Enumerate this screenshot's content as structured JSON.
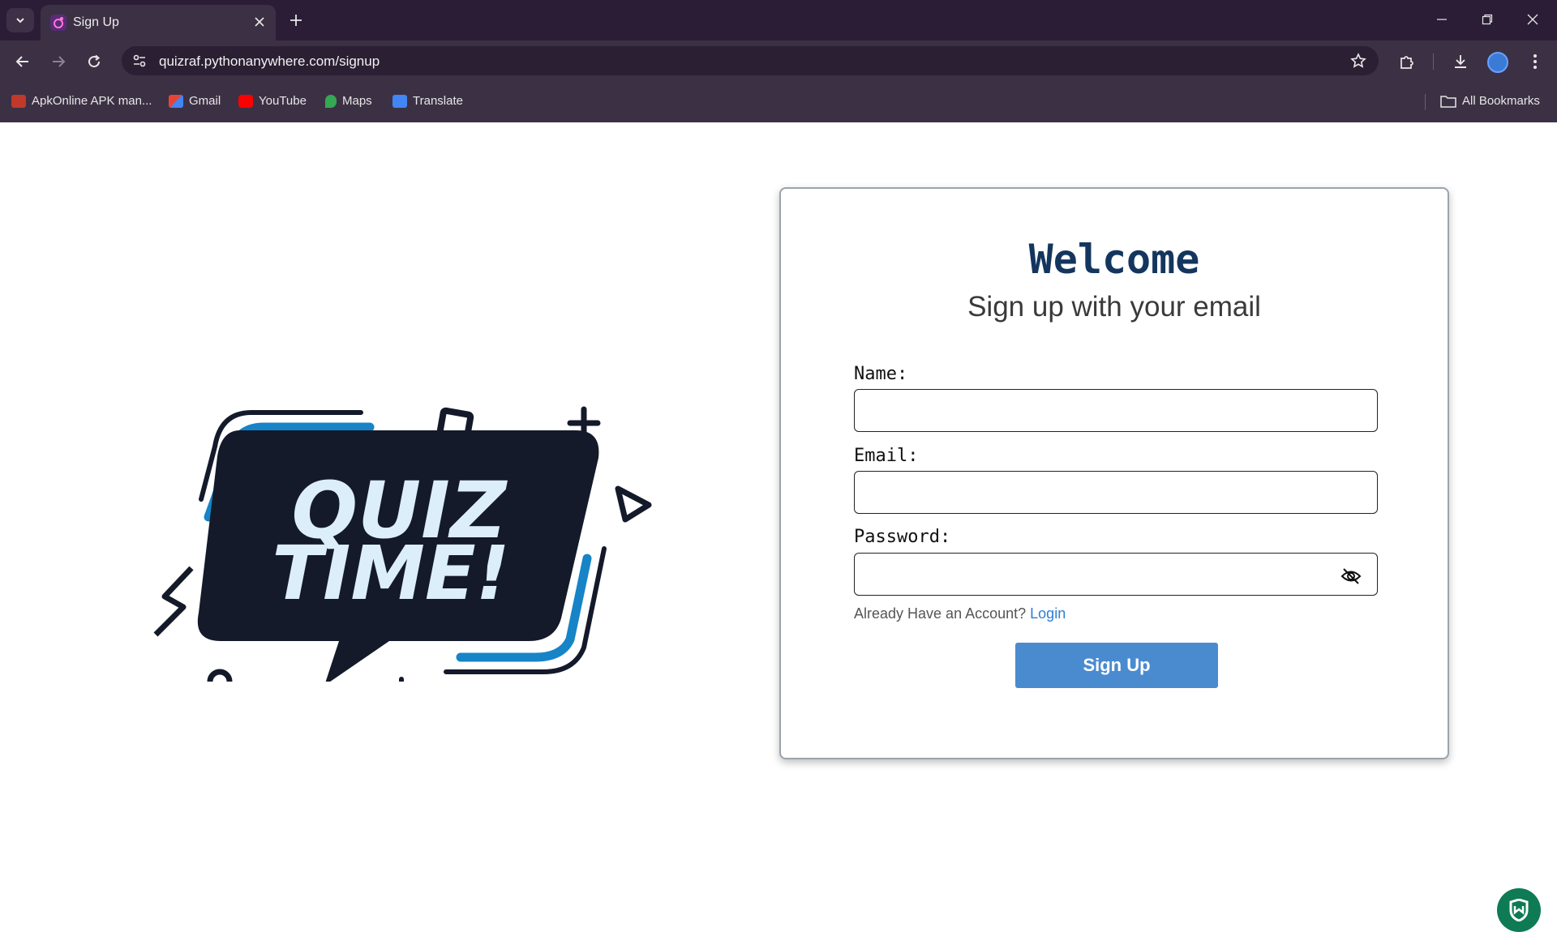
{
  "browser": {
    "tab_title": "Sign Up",
    "url": "quizraf.pythonanywhere.com/signup",
    "bookmarks": [
      {
        "label": "ApkOnline APK man...",
        "icon": "apkonline-icon",
        "color": "#c0392b"
      },
      {
        "label": "Gmail",
        "icon": "gmail-icon",
        "color": "#ea4335"
      },
      {
        "label": "YouTube",
        "icon": "youtube-icon",
        "color": "#ff0000"
      },
      {
        "label": "Maps",
        "icon": "maps-icon",
        "color": "#34a853"
      },
      {
        "label": "Translate",
        "icon": "translate-icon",
        "color": "#4285f4"
      }
    ],
    "all_bookmarks_label": "All Bookmarks"
  },
  "logo": {
    "line1": "QUIZ",
    "line2": "TIME!",
    "colors": {
      "dark": "#141a2a",
      "blue": "#1684c7",
      "text": "#dbeefa"
    }
  },
  "form": {
    "heading": "Welcome",
    "subheading": "Sign up with your email",
    "name_label": "Name:",
    "email_label": "Email:",
    "password_label": "Password:",
    "name_value": "",
    "email_value": "",
    "password_value": "",
    "account_prompt": "Already Have an Account?",
    "login_link": "Login",
    "submit_label": "Sign Up",
    "accent_color": "#4a8bd0"
  }
}
